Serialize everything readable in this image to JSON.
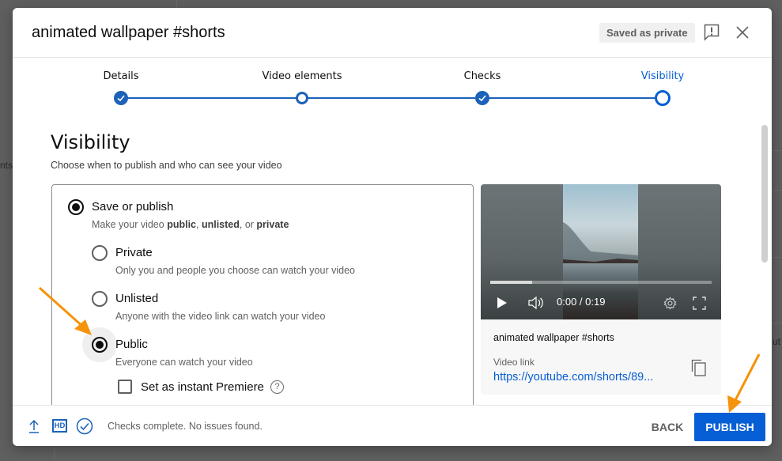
{
  "background": {
    "left_text_fragment": "nts",
    "right_text_fragment": "ut"
  },
  "dialog": {
    "title": "animated wallpaper #shorts",
    "saved_badge": "Saved as private",
    "icons": {
      "feedback": "feedback-icon",
      "close": "close-icon"
    }
  },
  "stepper": {
    "steps": [
      {
        "label": "Details",
        "state": "done"
      },
      {
        "label": "Video elements",
        "state": "open"
      },
      {
        "label": "Checks",
        "state": "done"
      },
      {
        "label": "Visibility",
        "state": "current"
      }
    ],
    "accent": "#065fd4"
  },
  "visibility": {
    "heading": "Visibility",
    "subheading": "Choose when to publish and who can see your video",
    "save_or_publish": {
      "label": "Save or publish",
      "desc_prefix": "Make your video ",
      "desc_public": "public",
      "desc_sep1": ", ",
      "desc_unlisted": "unlisted",
      "desc_sep2": ", or ",
      "desc_private": "private",
      "selected": true
    },
    "options": [
      {
        "label": "Private",
        "desc": "Only you and people you choose can watch your video",
        "selected": false
      },
      {
        "label": "Unlisted",
        "desc": "Anyone with the video link can watch your video",
        "selected": false
      },
      {
        "label": "Public",
        "desc": "Everyone can watch your video",
        "selected": true
      }
    ],
    "premiere": {
      "label": "Set as instant Premiere",
      "checked": false,
      "help": "?"
    }
  },
  "preview": {
    "time": "0:00 / 0:19",
    "progress": 0.19,
    "title": "animated wallpaper #shorts",
    "link_label": "Video link",
    "link": "https://youtube.com/shorts/89..."
  },
  "footer": {
    "hd_label": "HD",
    "status": "Checks complete. No issues found.",
    "back_label": "BACK",
    "publish_label": "PUBLISH"
  },
  "annotations": {
    "arrow_color": "#f5930a"
  }
}
